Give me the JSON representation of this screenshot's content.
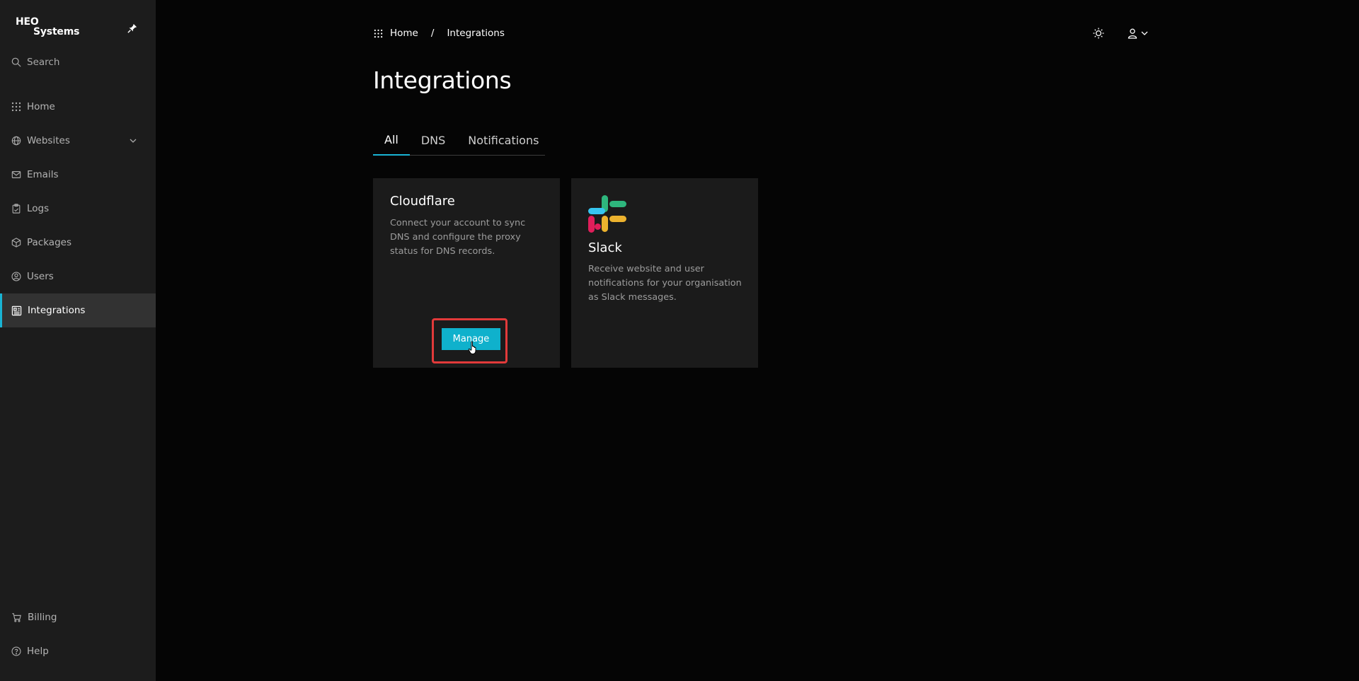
{
  "brand": {
    "line1": "HEO",
    "line2": "Systems"
  },
  "sidebar": {
    "search_label": "Search",
    "items": [
      {
        "label": "Home",
        "icon": "grid-icon"
      },
      {
        "label": "Websites",
        "icon": "globe-icon"
      },
      {
        "label": "Emails",
        "icon": "mail-icon"
      },
      {
        "label": "Logs",
        "icon": "clipboard-icon"
      },
      {
        "label": "Packages",
        "icon": "package-icon"
      },
      {
        "label": "Users",
        "icon": "user-circle-icon"
      },
      {
        "label": "Integrations",
        "icon": "integrations-icon"
      }
    ],
    "bottom": [
      {
        "label": "Billing",
        "icon": "cart-icon"
      },
      {
        "label": "Help",
        "icon": "help-icon"
      }
    ]
  },
  "breadcrumb": {
    "home": "Home",
    "separator": "/",
    "current": "Integrations"
  },
  "page": {
    "title": "Integrations"
  },
  "tabs": [
    {
      "label": "All"
    },
    {
      "label": "DNS"
    },
    {
      "label": "Notifications"
    }
  ],
  "cards": {
    "cloudflare": {
      "title": "Cloudflare",
      "description": "Connect your account to sync DNS and configure the proxy status for DNS records.",
      "button": "Manage"
    },
    "slack": {
      "title": "Slack",
      "description": "Receive website and user notifications for your organisation as Slack messages."
    }
  },
  "colors": {
    "accent": "#19b4d4",
    "highlight": "#e23a3a",
    "sidebar_bg": "#1c1c1c",
    "page_bg": "#050505",
    "card_bg": "#1b1b1b"
  }
}
